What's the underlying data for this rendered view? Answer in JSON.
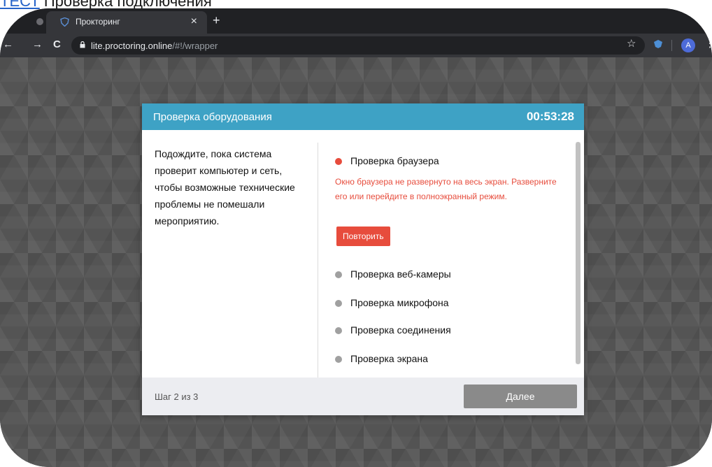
{
  "page_caption": {
    "link_part": "ТЕСТ",
    "text": "Проверка подключения"
  },
  "browser": {
    "tab_title": "Прокторинг",
    "tab_close": "×",
    "new_tab": "+",
    "url_host": "lite.proctoring.online",
    "url_path": "/#!/wrapper",
    "avatar_letter": "A",
    "back": "←",
    "forward": "→",
    "reload": "C",
    "star": "☆",
    "menu": "⋮"
  },
  "modal": {
    "title": "Проверка оборудования",
    "timer": "00:53:28",
    "intro": "Подождите, пока система проверит компьютер и сеть, чтобы возможные технические проблемы не помешали мероприятию.",
    "checks": [
      {
        "label": "Проверка браузера",
        "status": "error",
        "color": "#e74c3c"
      },
      {
        "label": "Проверка веб-камеры",
        "status": "pending",
        "color": "#a0a0a0"
      },
      {
        "label": "Проверка микрофона",
        "status": "pending",
        "color": "#a0a0a0"
      },
      {
        "label": "Проверка соединения",
        "status": "pending",
        "color": "#a0a0a0"
      },
      {
        "label": "Проверка экрана",
        "status": "pending",
        "color": "#a0a0a0"
      }
    ],
    "error_message": "Окно браузера не развернуто на весь экран. Разверните его или перейдите в полноэкранный режим.",
    "retry_label": "Повторить",
    "step_text": "Шаг 2 из 3",
    "next_label": "Далее"
  },
  "colors": {
    "header": "#3ea2c5",
    "error": "#e74c3c",
    "pending": "#a0a0a0",
    "next_button": "#8a8a8a"
  }
}
